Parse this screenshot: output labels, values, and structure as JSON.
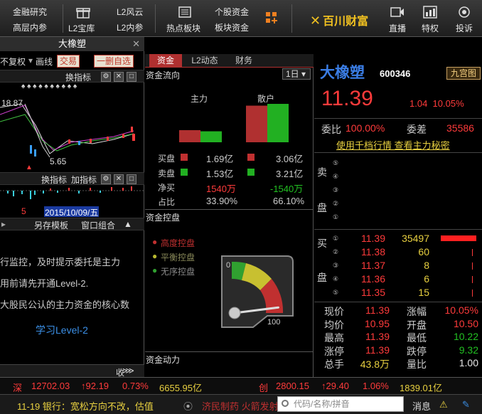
{
  "topbar": {
    "items_left": [
      {
        "id": "research",
        "label": "金融研究"
      },
      {
        "id": "insider",
        "label": "高层内参"
      },
      {
        "id": "l2treasure",
        "label": "L2宝库"
      },
      {
        "id": "l2risk",
        "label": "L2风云"
      },
      {
        "id": "l2insider",
        "label": "L2内参"
      },
      {
        "id": "hot",
        "label": "热点板块"
      },
      {
        "id": "stockfund",
        "label": "个股资金"
      },
      {
        "id": "sectorfund",
        "label": "板块资金"
      }
    ],
    "logo": "百川财富",
    "items_right": [
      {
        "id": "live",
        "label": "直播"
      },
      {
        "id": "special",
        "label": "特权"
      },
      {
        "id": "suggest",
        "label": "投诉"
      }
    ]
  },
  "left": {
    "title": "大橡塑",
    "toolbar": {
      "restore": "不复权",
      "period": "画线",
      "trade": "交易",
      "delete": "一删自选"
    },
    "indicator_btn": "换指标",
    "price_label": "18.87",
    "low_label": "5.65",
    "bar2": {
      "swap": "换指标",
      "add": "加指标"
    },
    "date_label": "2015/10/09/五",
    "date_mark": "5",
    "bar3": {
      "save": "另存模板",
      "window": "窗口组合"
    },
    "promo": [
      "行监控，及时提示委托是主力",
      "用前请先开通Level-2.",
      "大股民公认的主力资金的核心数"
    ],
    "learn": "学习Level-2",
    "fold": "收起"
  },
  "mid": {
    "tabs": [
      "资金",
      "L2动态",
      "财务"
    ],
    "section1": "资金流向",
    "period": "1日",
    "main_label": "主力",
    "retail_label": "散户",
    "rows": [
      {
        "label": "买盘",
        "main": "1.69亿",
        "retail": "3.06亿"
      },
      {
        "label": "卖盘",
        "main": "1.53亿",
        "retail": "3.21亿"
      },
      {
        "label": "净买",
        "main": "1540万",
        "retail": "-1540万"
      },
      {
        "label": "占比",
        "main": "33.90%",
        "retail": "66.10%"
      }
    ],
    "main_bars": {
      "buy": 1.69,
      "sell": 1.53
    },
    "retail_bars": {
      "buy": 3.06,
      "sell": 3.21
    },
    "section2": "资金控盘",
    "legend": [
      "高度控盘",
      "平衡控盘",
      "无序控盘"
    ],
    "gauge": {
      "min": "0",
      "max": "100",
      "value": 92
    },
    "section3": "资金动力"
  },
  "right": {
    "name": "大橡塑",
    "code": "600346",
    "nine": "九宫图",
    "price": "11.39",
    "change": "1.04",
    "pct": "10.05%",
    "webi_label": "委比",
    "webi": "100.00%",
    "weicha_label": "委差",
    "weicha": "35586",
    "link": "使用千档行情 查看主力秘密",
    "sell_label": [
      "卖",
      "盘"
    ],
    "buy_label": [
      "买",
      "盘"
    ],
    "sell_nums": [
      "⑤",
      "④",
      "③",
      "②",
      "①"
    ],
    "buy": [
      {
        "n": "①",
        "price": "11.39",
        "vol": "35497"
      },
      {
        "n": "②",
        "price": "11.38",
        "vol": "60"
      },
      {
        "n": "③",
        "price": "11.37",
        "vol": "8"
      },
      {
        "n": "④",
        "price": "11.36",
        "vol": "6"
      },
      {
        "n": "⑤",
        "price": "11.35",
        "vol": "15"
      }
    ],
    "stats": [
      {
        "l1": "现价",
        "v1": "11.39",
        "l2": "涨幅",
        "v2": "10.05%"
      },
      {
        "l1": "均价",
        "v1": "10.95",
        "l2": "开盘",
        "v2": "10.50"
      },
      {
        "l1": "最高",
        "v1": "11.39",
        "l2": "最低",
        "v2": "10.22"
      },
      {
        "l1": "涨停",
        "v1": "11.39",
        "l2": "跌停",
        "v2": "9.32"
      },
      {
        "l1": "总手",
        "v1": "43.8万",
        "l2": "量比",
        "v2": "1.00"
      }
    ]
  },
  "status": {
    "sz_label": "深",
    "sz_index": "12702.03",
    "sz_chg": "92.19",
    "sz_pct": "0.73%",
    "sz_amount": "6655.95亿",
    "cy_label": "创",
    "cy_index": "2800.15",
    "cy_chg": "29.40",
    "cy_pct": "1.06%",
    "cy_amount": "1839.01亿",
    "news": "11-19 银行：宽松方向不改，估值",
    "ticker": "济民制药 火箭发射",
    "search_placeholder": "代码/名称/拼音",
    "msg": "消息"
  }
}
